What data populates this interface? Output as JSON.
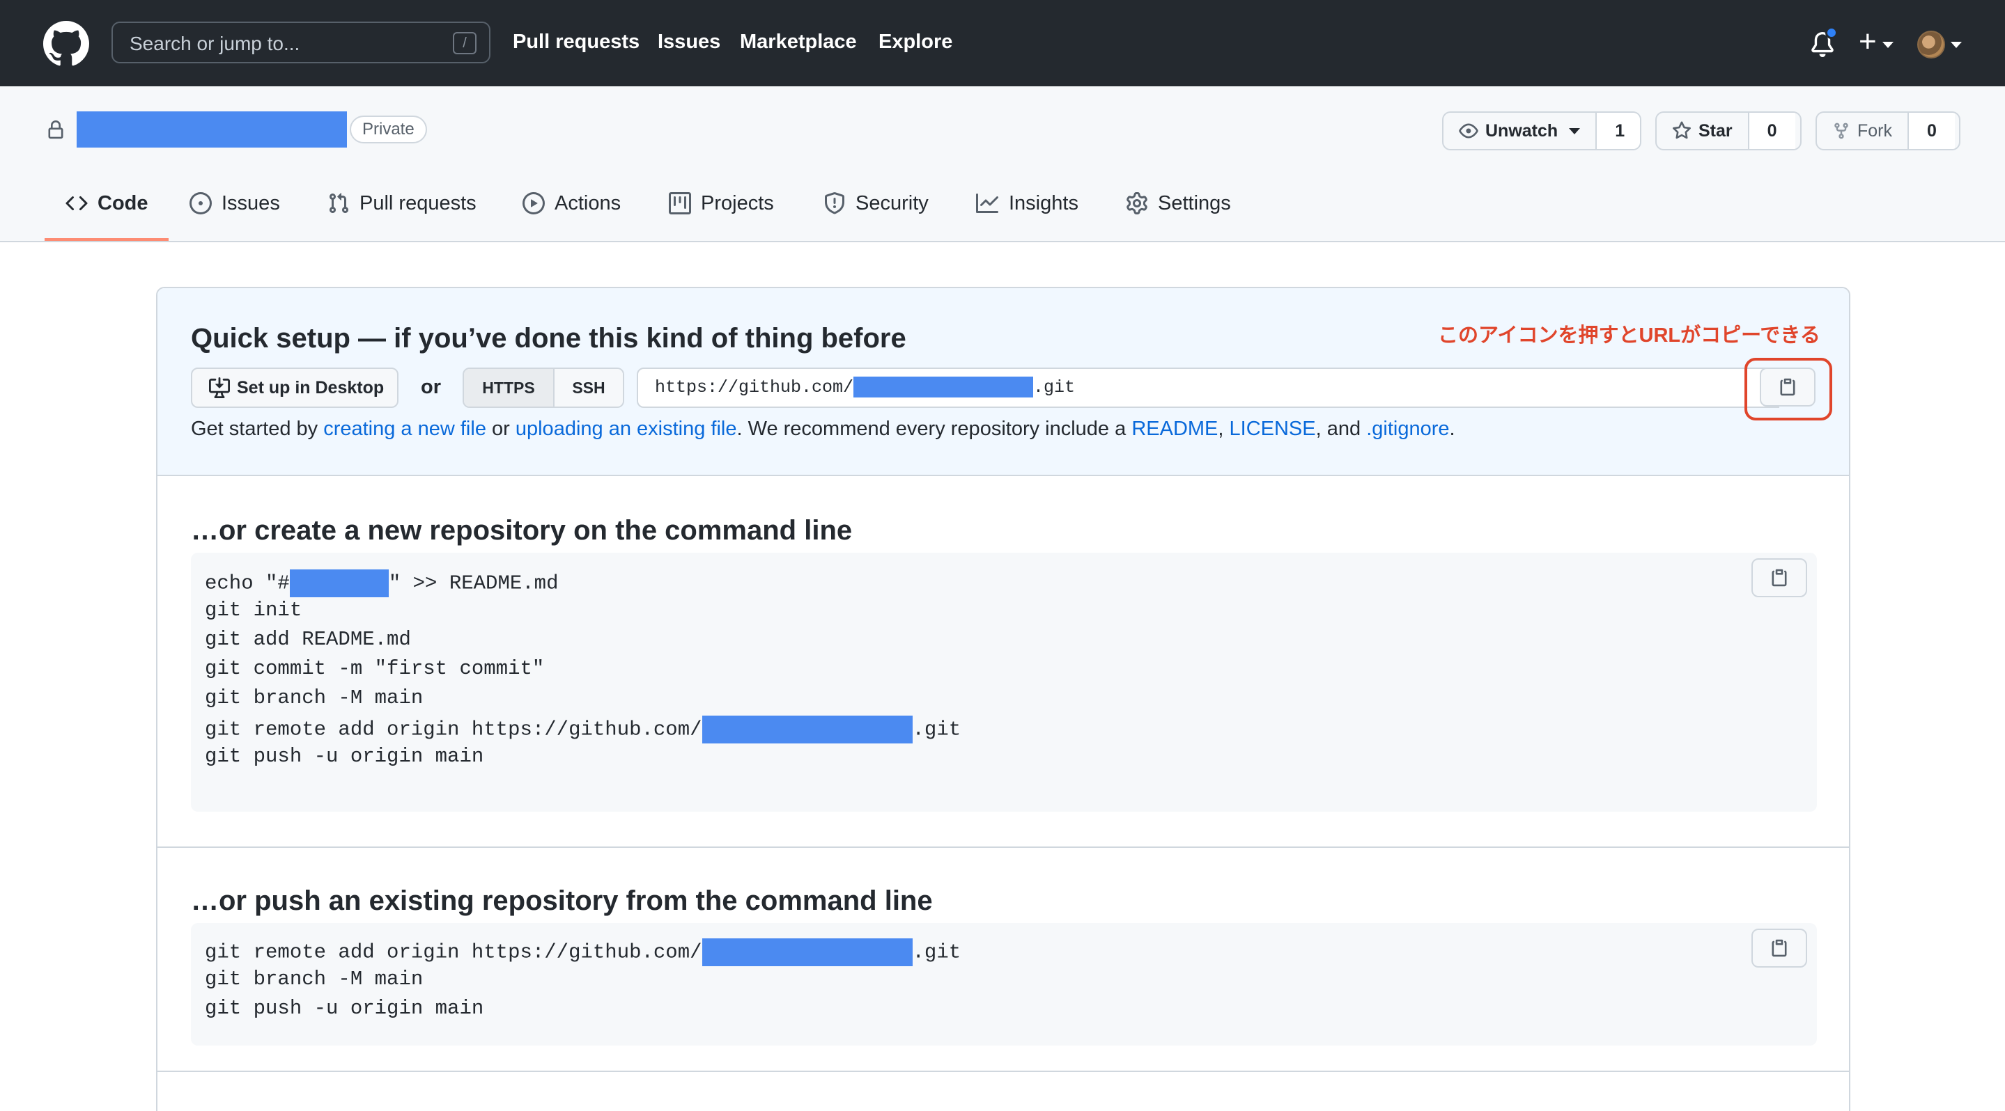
{
  "header": {
    "search_placeholder": "Search or jump to...",
    "search_shortcut": "/",
    "nav": [
      "Pull requests",
      "Issues",
      "Marketplace",
      "Explore"
    ]
  },
  "repo": {
    "visibility_badge": "Private",
    "watch": {
      "label": "Unwatch",
      "count": "1"
    },
    "star": {
      "label": "Star",
      "count": "0"
    },
    "fork": {
      "label": "Fork",
      "count": "0"
    },
    "tabs": [
      "Code",
      "Issues",
      "Pull requests",
      "Actions",
      "Projects",
      "Security",
      "Insights",
      "Settings"
    ],
    "active_tab": "Code"
  },
  "quick_setup": {
    "title": "Quick setup — if you’ve done this kind of thing before",
    "annotation": "このアイコンを押すとURLがコピーできる",
    "desktop_button": "Set up in Desktop",
    "or": "or",
    "protocols": [
      "HTTPS",
      "SSH"
    ],
    "url_prefix": "https://github.com/",
    "url_suffix": ".git",
    "get_started": {
      "t1": "Get started by ",
      "l1": "creating a new file",
      "t2": " or ",
      "l2": "uploading an existing file",
      "t3": ". We recommend every repository include a ",
      "l3": "README",
      "t4": ", ",
      "l4": "LICENSE",
      "t5": ", and ",
      "l5": ".gitignore",
      "t6": "."
    }
  },
  "new_repo": {
    "title": "…or create a new repository on the command line",
    "line1_a": "echo \"#",
    "line1_b": "\" >> README.md",
    "line2": "git init",
    "line3": "git add README.md",
    "line4": "git commit -m \"first commit\"",
    "line5": "git branch -M main",
    "line6_a": "git remote add origin https://github.com/",
    "line6_b": ".git",
    "line7": "git push -u origin main"
  },
  "push_existing": {
    "title": "…or push an existing repository from the command line",
    "line1_a": "git remote add origin https://github.com/",
    "line1_b": ".git",
    "line2": "git branch -M main",
    "line3": "git push -u origin main"
  },
  "colors": {
    "header_bg": "#24292f",
    "link": "#0969da",
    "annotation_red": "#e0452b",
    "active_tab_underline": "#fd8c73",
    "redaction_blue": "#4b8af1"
  }
}
